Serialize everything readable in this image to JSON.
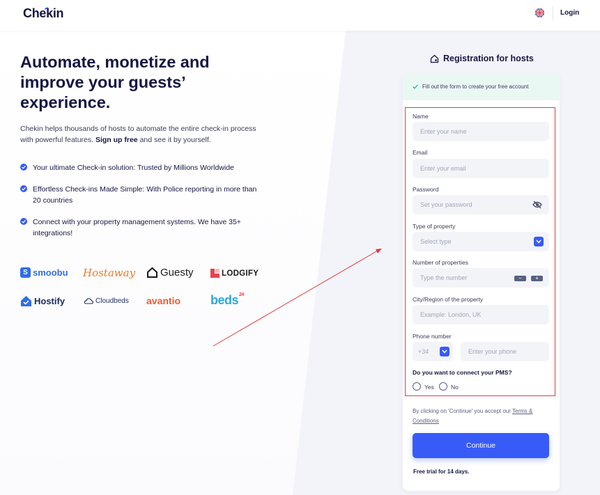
{
  "header": {
    "logo": "Chekin",
    "login": "Login"
  },
  "hero": {
    "title": "Automate, monetize and improve your guests’ experience.",
    "text_before": "Chekin helps thousands of hosts to automate the entire check-in process with powerful features. ",
    "text_bold": "Sign up free",
    "text_after": " and see it by yourself.",
    "features": [
      "Your ultimate Check-in solution: Trusted by Millions Worldwide",
      "Effortless Check-ins Made Simple: With Police reporting in more than 20 countries",
      "Connect with your property management systems. We have 35+ integrations!"
    ]
  },
  "partners": [
    {
      "name": "smoobu",
      "color": "#2f6ee6"
    },
    {
      "name": "Hostaway",
      "color": "#f07b25"
    },
    {
      "name": "Guesty",
      "color": "#1a1a1a"
    },
    {
      "name": "LODGIFY",
      "color": "#1a1a1a"
    },
    {
      "name": "Hostify",
      "color": "#1b2a5c"
    },
    {
      "name": "Cloudbeds",
      "color": "#1b2a5c"
    },
    {
      "name": "avantio",
      "color": "#ef5b32"
    },
    {
      "name": "beds",
      "badge": "24",
      "color": "#2fa6e0"
    }
  ],
  "registration": {
    "title": "Registration for hosts",
    "notice": "Fill out the form to create your free account",
    "name_label": "Name",
    "name_placeholder": "Enter your name",
    "email_label": "Email",
    "email_placeholder": "Enter your email",
    "password_label": "Password",
    "password_placeholder": "Set your password",
    "type_label": "Type of property",
    "type_placeholder": "Select type",
    "count_label": "Number of properties",
    "count_placeholder": "Type the number",
    "stepper_minus": "−",
    "stepper_plus": "+",
    "city_label": "City/Region of the property",
    "city_placeholder": "Example: London, UK",
    "phone_label": "Phone number",
    "phone_code": "+34",
    "phone_placeholder": "Enter your phone",
    "pms_question": "Do you want to connect your PMS?",
    "yes": "Yes",
    "no": "No",
    "terms_prefix": "By clicking on 'Continue' you accept our ",
    "terms_link": "Terms & Conditions",
    "continue": "Continue",
    "trial": "Free trial for 14 days."
  },
  "colors": {
    "primary": "#385bf8",
    "navy": "#161643",
    "notice_bg": "#eaf8f4",
    "notice_check": "#1ab394",
    "annotation": "#e23c3c"
  }
}
